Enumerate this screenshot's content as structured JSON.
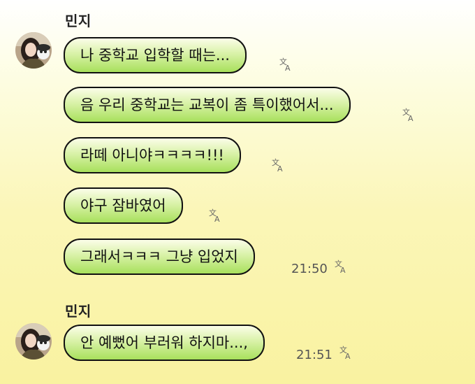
{
  "groups": [
    {
      "sender": "민지",
      "messages": [
        {
          "text": "나 중학교 입학할 때는..."
        },
        {
          "text": "음 우리 중학교는 교복이 좀 특이했어서..."
        },
        {
          "text": "라떼 아니야ㅋㅋㅋㅋ!!!"
        },
        {
          "text": "야구 잠바였어"
        },
        {
          "text": "그래서ㅋㅋㅋ 그냥 입었지",
          "time": "21:50"
        }
      ]
    },
    {
      "sender": "민지",
      "messages": [
        {
          "text": "안 예뻤어 부러워 하지마...,",
          "time": "21:51"
        }
      ]
    }
  ],
  "colors": {
    "bubble_top": "#fbfde8",
    "bubble_bottom": "#a8e05c",
    "bubble_border": "#111111",
    "background_top": "#ffffff",
    "background_bottom": "#f9f2a0"
  },
  "icons": {
    "translate": "translate-icon",
    "avatar": "avatar"
  }
}
